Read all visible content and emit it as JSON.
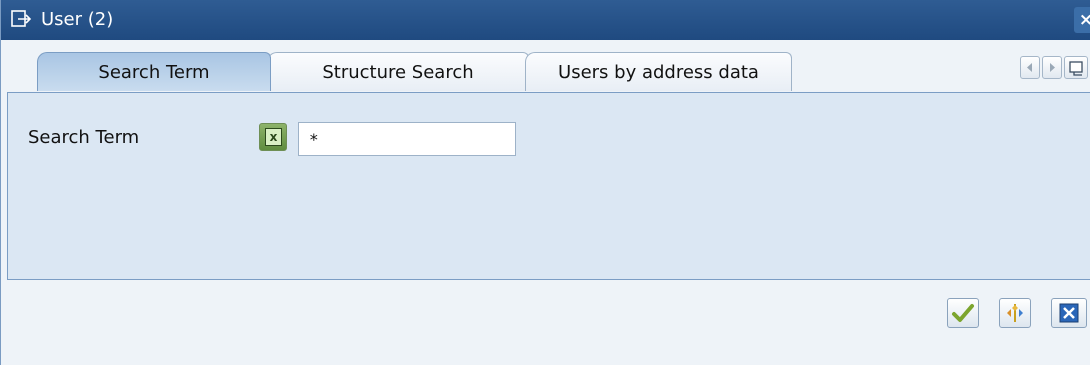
{
  "window": {
    "title": "User (2)",
    "icon": "dialog-arrow-icon",
    "close_icon": "close-icon",
    "close_glyph": "×"
  },
  "tabs": [
    {
      "label": "Search Term",
      "active": true
    },
    {
      "label": "Structure Search",
      "active": false
    },
    {
      "label": "Users by address data",
      "active": false
    }
  ],
  "tab_nav": [
    "scroll-left-icon",
    "scroll-right-icon",
    "tab-list-icon"
  ],
  "search_term": {
    "label": "Search Term",
    "selection_icon": "multiple-selection-icon",
    "selection_glyph": "x",
    "value": "*"
  },
  "footer_buttons": [
    {
      "name": "continue-button",
      "icon": "checkmark-icon"
    },
    {
      "name": "new-search-button",
      "icon": "search-help-icon"
    },
    {
      "name": "cancel-button",
      "icon": "cancel-x-icon"
    }
  ],
  "colors": {
    "titlebar": "#1f4a80",
    "active_tab": "#bcd3ea",
    "panel": "#dbe7f3",
    "background": "#eef3f8",
    "checkmark": "#7ca52e",
    "cancel": "#2a66b8"
  }
}
